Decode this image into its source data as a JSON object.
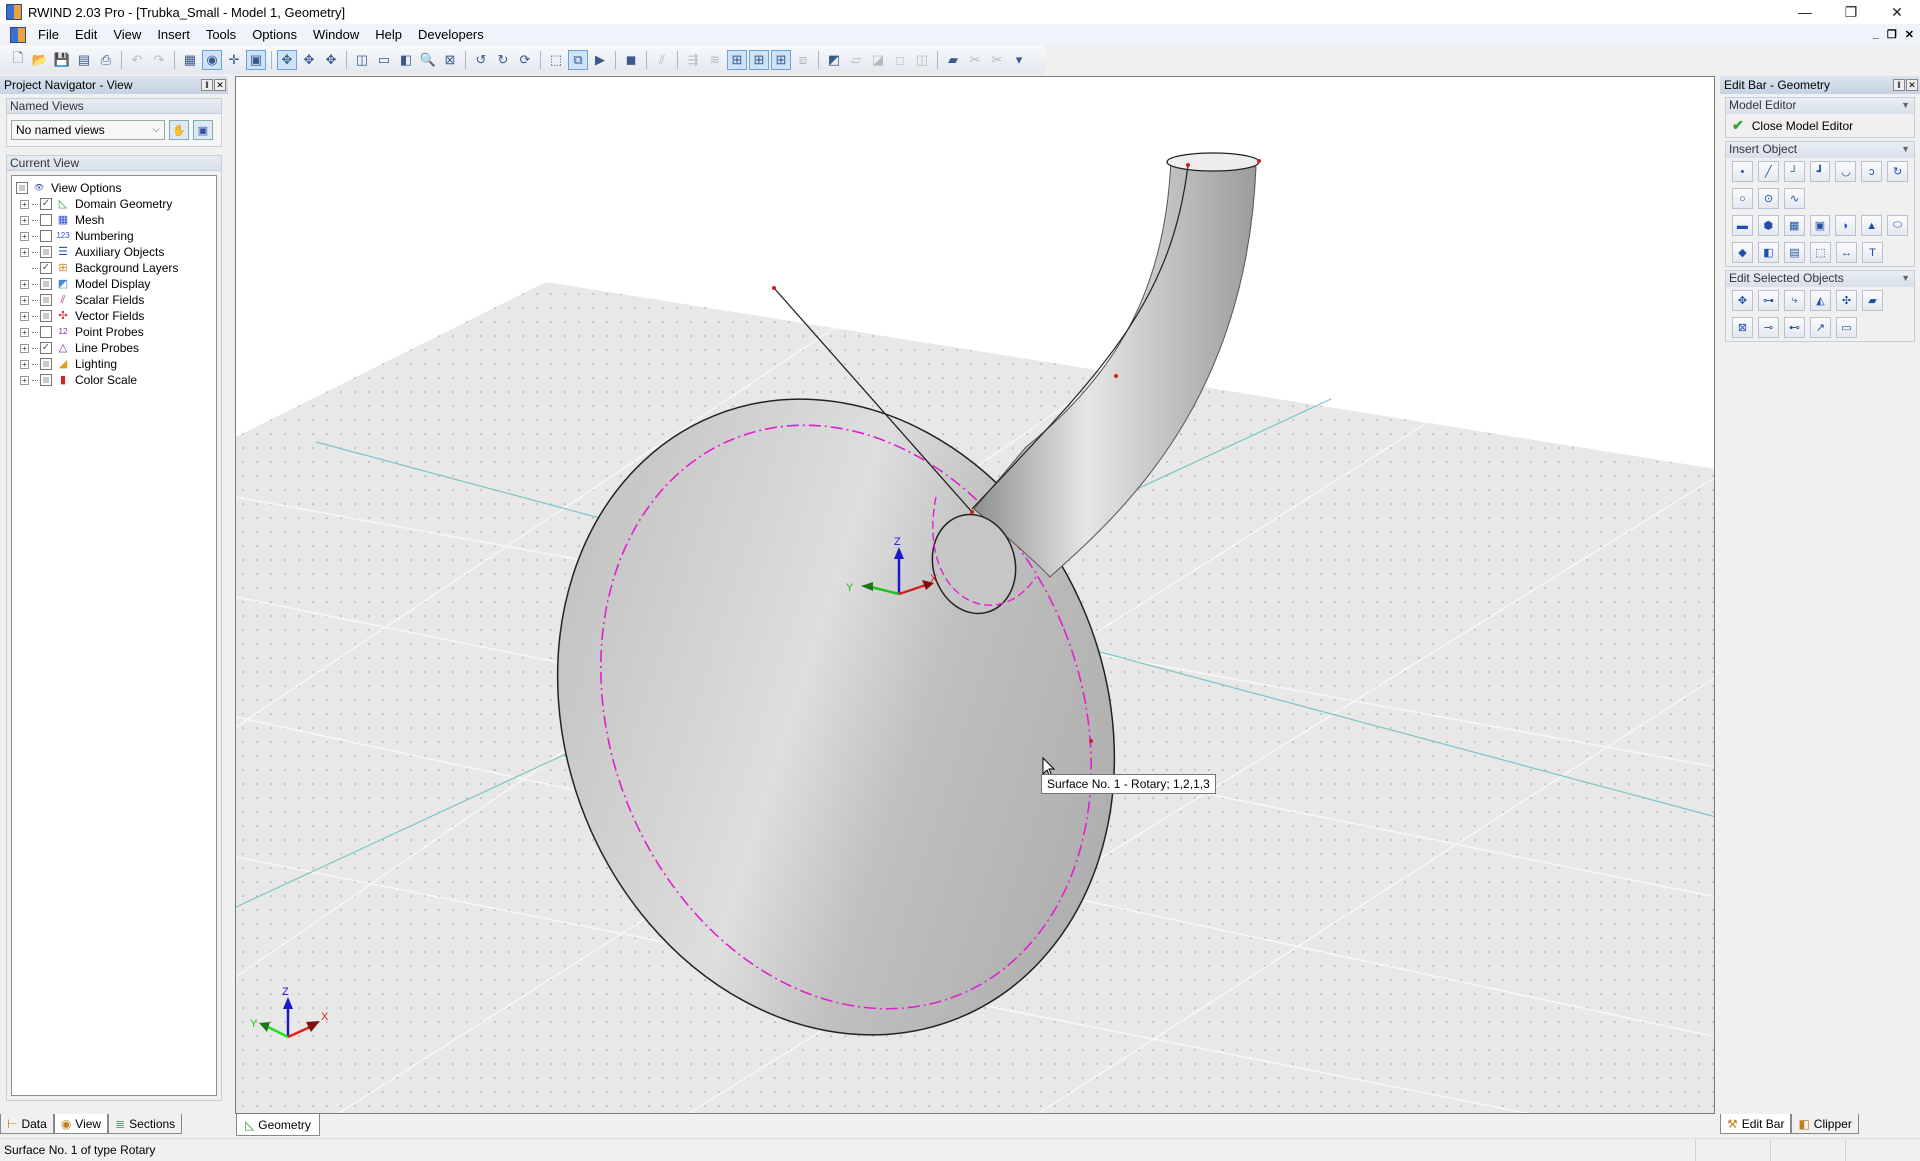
{
  "window": {
    "title": "RWIND 2.03 Pro - [Trubka_Small - Model 1, Geometry]",
    "controls": {
      "minimize": "—",
      "restore": "❐",
      "close": "✕"
    },
    "mdi_controls": {
      "minimize": "_",
      "restore": "❐",
      "close": "✕"
    }
  },
  "menu": [
    "File",
    "Edit",
    "View",
    "Insert",
    "Tools",
    "Options",
    "Window",
    "Help",
    "Developers"
  ],
  "toolbar": {
    "buttons": [
      {
        "name": "new-icon",
        "glyph": "🗋",
        "state": "normal"
      },
      {
        "name": "open-icon",
        "glyph": "📂",
        "state": "normal"
      },
      {
        "name": "save-icon",
        "glyph": "💾",
        "state": "normal"
      },
      {
        "name": "model-data-icon",
        "glyph": "▤",
        "state": "normal"
      },
      {
        "name": "print-icon",
        "glyph": "⎙",
        "state": "normal"
      },
      {
        "sep": true
      },
      {
        "name": "undo-icon",
        "glyph": "↶",
        "state": "disabled"
      },
      {
        "name": "redo-icon",
        "glyph": "↷",
        "state": "disabled"
      },
      {
        "sep": true
      },
      {
        "name": "select-icon",
        "glyph": "▦",
        "state": "normal"
      },
      {
        "name": "view-visibility-icon",
        "glyph": "◉",
        "state": "active"
      },
      {
        "name": "grid-icon",
        "glyph": "✛",
        "state": "normal"
      },
      {
        "name": "snap-icon",
        "glyph": "▣",
        "state": "active"
      },
      {
        "sep": true
      },
      {
        "name": "rotate-view-icon",
        "glyph": "✥",
        "state": "active"
      },
      {
        "name": "rotate-x-icon",
        "glyph": "✥",
        "state": "normal"
      },
      {
        "name": "rotate-y-icon",
        "glyph": "✥",
        "state": "normal"
      },
      {
        "sep": true
      },
      {
        "name": "iso-view-icon",
        "glyph": "◫",
        "state": "normal"
      },
      {
        "name": "pan-icon",
        "glyph": "▭",
        "state": "normal"
      },
      {
        "name": "previous-view-icon",
        "glyph": "◧",
        "state": "normal"
      },
      {
        "name": "zoom-icon",
        "glyph": "🔍",
        "state": "normal"
      },
      {
        "name": "zoom-all-icon",
        "glyph": "⊠",
        "state": "normal"
      },
      {
        "sep": true
      },
      {
        "name": "rotate-left-icon",
        "glyph": "↺",
        "state": "normal"
      },
      {
        "name": "rotate-right-icon",
        "glyph": "↻",
        "state": "normal"
      },
      {
        "name": "rotate-free-icon",
        "glyph": "⟳",
        "state": "normal"
      },
      {
        "sep": true
      },
      {
        "name": "wireframe-icon",
        "glyph": "⬚",
        "state": "normal"
      },
      {
        "name": "view-mode-icon",
        "glyph": "⧉",
        "state": "active"
      },
      {
        "name": "color-display-icon",
        "glyph": "▶",
        "state": "normal"
      },
      {
        "sep": true
      },
      {
        "name": "render-mode-icon",
        "glyph": "◼",
        "state": "normal"
      },
      {
        "sep": true
      },
      {
        "name": "lines-icon",
        "glyph": "⫽",
        "state": "disabled"
      },
      {
        "sep": true
      },
      {
        "name": "arrows-icon",
        "glyph": "⇶",
        "state": "disabled"
      },
      {
        "name": "streamlines-icon",
        "glyph": "≋",
        "state": "disabled"
      },
      {
        "name": "probe-a-icon",
        "glyph": "⊞",
        "state": "active"
      },
      {
        "name": "probe-b-icon",
        "glyph": "⊞",
        "state": "active"
      },
      {
        "name": "probe-c-icon",
        "glyph": "⊞",
        "state": "active"
      },
      {
        "name": "layers-icon",
        "glyph": "⧈",
        "state": "disabled"
      },
      {
        "sep": true
      },
      {
        "name": "clipper-icon",
        "glyph": "◩",
        "state": "normal"
      },
      {
        "name": "plane-icon",
        "glyph": "▱",
        "state": "disabled"
      },
      {
        "name": "slice-a-icon",
        "glyph": "◪",
        "state": "disabled"
      },
      {
        "name": "slice-b-icon",
        "glyph": "□",
        "state": "disabled"
      },
      {
        "name": "slice-c-icon",
        "glyph": "◫",
        "state": "disabled"
      },
      {
        "sep": true
      },
      {
        "name": "surface-select-icon",
        "glyph": "▰",
        "state": "normal"
      },
      {
        "name": "cut-lines-icon",
        "glyph": "✂",
        "state": "disabled"
      },
      {
        "name": "cut-delete-icon",
        "glyph": "✂",
        "state": "disabled"
      },
      {
        "name": "toolbar-overflow-icon",
        "glyph": "▾",
        "state": "normal"
      }
    ]
  },
  "left_panel": {
    "title": "Project Navigator - View",
    "named_views": {
      "header": "Named Views",
      "selected": "No named views"
    },
    "current_view": {
      "header": "Current View",
      "items": [
        {
          "label": "View Options",
          "expander": false,
          "check": "partial",
          "icon": "eye-icon",
          "glyph": "👁",
          "color": "#3a5aa0",
          "root": true
        },
        {
          "label": "Domain Geometry",
          "expander": true,
          "check": "checked",
          "icon": "geometry-icon",
          "glyph": "◺",
          "color": "#2f9e3a"
        },
        {
          "label": "Mesh",
          "expander": true,
          "check": "unchecked",
          "icon": "mesh-icon",
          "glyph": "▦",
          "color": "#3050d0"
        },
        {
          "label": "Numbering",
          "expander": true,
          "check": "unchecked",
          "icon": "numbering-icon",
          "glyph": "123",
          "color": "#3050d0"
        },
        {
          "label": "Auxiliary Objects",
          "expander": true,
          "check": "partial",
          "icon": "auxiliary-objects-icon",
          "glyph": "☰",
          "color": "#3050d0"
        },
        {
          "label": "Background Layers",
          "expander": false,
          "check": "checked",
          "icon": "background-layers-icon",
          "glyph": "⊞",
          "color": "#d08a20"
        },
        {
          "label": "Model Display",
          "expander": true,
          "check": "partial",
          "icon": "model-display-icon",
          "glyph": "◩",
          "color": "#4a8ad8"
        },
        {
          "label": "Scalar Fields",
          "expander": true,
          "check": "partial",
          "icon": "scalar-fields-icon",
          "glyph": "⫽",
          "color": "#d02080"
        },
        {
          "label": "Vector Fields",
          "expander": true,
          "check": "partial",
          "icon": "vector-fields-icon",
          "glyph": "✣",
          "color": "#d03030"
        },
        {
          "label": "Point Probes",
          "expander": true,
          "check": "unchecked",
          "icon": "point-probes-icon",
          "glyph": "12",
          "color": "#7030a0"
        },
        {
          "label": "Line Probes",
          "expander": true,
          "check": "checked",
          "icon": "line-probes-icon",
          "glyph": "△",
          "color": "#7030a0"
        },
        {
          "label": "Lighting",
          "expander": true,
          "check": "partial",
          "icon": "lighting-icon",
          "glyph": "◢",
          "color": "#e0a020"
        },
        {
          "label": "Color Scale",
          "expander": true,
          "check": "partial",
          "icon": "color-scale-icon",
          "glyph": "▮",
          "color": "#e02020"
        }
      ]
    },
    "tabs": [
      {
        "label": "Data",
        "icon": "data-tree-icon",
        "glyph": "⊢",
        "selected": false
      },
      {
        "label": "View",
        "icon": "eye-icon",
        "glyph": "◉",
        "selected": true
      },
      {
        "label": "Sections",
        "icon": "sections-icon",
        "glyph": "≣",
        "selected": false
      }
    ]
  },
  "viewport": {
    "tab_label": "Geometry",
    "tooltip": "Surface No. 1 - Rotary; 1,2,1,3",
    "axes": {
      "x": "X",
      "y": "Y",
      "z": "Z"
    }
  },
  "right_panel": {
    "title": "Edit Bar - Geometry",
    "model_editor": {
      "header": "Model Editor",
      "close_label": "Close Model Editor"
    },
    "insert_object": {
      "header": "Insert Object",
      "rows": [
        [
          {
            "name": "insert-node-icon",
            "glyph": "•"
          },
          {
            "name": "insert-line-icon",
            "glyph": "╱"
          },
          {
            "name": "insert-polyline-icon",
            "glyph": "┘"
          },
          {
            "name": "insert-polyline-step-icon",
            "glyph": "┛"
          },
          {
            "name": "insert-arc-icon",
            "glyph": "◡"
          },
          {
            "name": "insert-arc-3pt-icon",
            "glyph": "ↄ"
          },
          {
            "name": "insert-arc-center-icon",
            "glyph": "↻"
          }
        ],
        [
          {
            "name": "insert-circle-icon",
            "glyph": "○"
          },
          {
            "name": "insert-circle-center-icon",
            "glyph": "⊙"
          },
          {
            "name": "insert-spline-icon",
            "glyph": "∿"
          }
        ],
        [
          {
            "name": "insert-surface-icon",
            "glyph": "▬"
          },
          {
            "name": "insert-polygon-surface-icon",
            "glyph": "⬢"
          },
          {
            "name": "insert-grid-surface-icon",
            "glyph": "▦"
          },
          {
            "name": "insert-quad-surface-icon",
            "glyph": "▣"
          },
          {
            "name": "insert-curved-surface-icon",
            "glyph": "◗"
          },
          {
            "name": "insert-cone-icon",
            "glyph": "▲"
          },
          {
            "name": "insert-cylinder-icon",
            "glyph": "⬭"
          }
        ],
        [
          {
            "name": "insert-plane-icon",
            "glyph": "◆"
          },
          {
            "name": "insert-solid-icon",
            "glyph": "◧"
          },
          {
            "name": "insert-extrude-icon",
            "glyph": "▤"
          },
          {
            "name": "insert-box-icon",
            "glyph": "⬚"
          },
          {
            "name": "insert-dimension-icon",
            "glyph": "↔"
          },
          {
            "name": "insert-text-icon",
            "glyph": "T"
          }
        ]
      ]
    },
    "edit_selected": {
      "header": "Edit Selected Objects",
      "rows": [
        [
          {
            "name": "move-copy-icon",
            "glyph": "✥"
          },
          {
            "name": "connect-icon",
            "glyph": "⊶"
          },
          {
            "name": "rotate-objects-icon",
            "glyph": "⤷"
          },
          {
            "name": "mirror-icon",
            "glyph": "◭"
          },
          {
            "name": "scale-icon",
            "glyph": "✣"
          },
          {
            "name": "project-icon",
            "glyph": "▰"
          }
        ],
        [
          {
            "name": "delete-nodes-icon",
            "glyph": "⊠"
          },
          {
            "name": "divide-line-icon",
            "glyph": "⊸"
          },
          {
            "name": "divide-line-n-icon",
            "glyph": "⊷"
          },
          {
            "name": "extend-line-icon",
            "glyph": "↗"
          },
          {
            "name": "measure-icon",
            "glyph": "▭"
          }
        ]
      ]
    },
    "tabs": [
      {
        "label": "Edit Bar",
        "icon": "tools-icon",
        "glyph": "⚒",
        "selected": true
      },
      {
        "label": "Clipper",
        "icon": "clipper-box-icon",
        "glyph": "◧",
        "selected": false
      }
    ]
  },
  "status_bar": {
    "text": "Surface No. 1 of type Rotary"
  }
}
